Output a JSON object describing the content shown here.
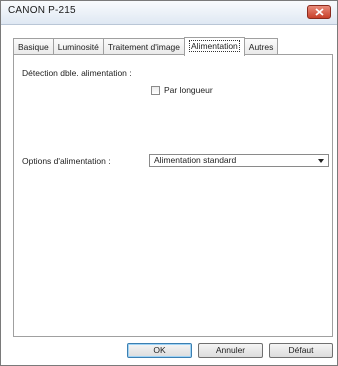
{
  "window": {
    "title": "CANON  P-215"
  },
  "tabs": [
    {
      "label": "Basique"
    },
    {
      "label": "Luminosité"
    },
    {
      "label": "Traitement d'image"
    },
    {
      "label": "Alimentation",
      "active": true
    },
    {
      "label": "Autres"
    }
  ],
  "panel": {
    "double_feed_label": "Détection dble. alimentation :",
    "by_length_checkbox": {
      "label": "Par longueur",
      "checked": false
    },
    "feed_options_label": "Options d'alimentation :",
    "feed_options_select": {
      "value": "Alimentation standard"
    }
  },
  "buttons": {
    "ok": "OK",
    "cancel": "Annuler",
    "default": "Défaut"
  },
  "colors": {
    "close_button": "#c8402a",
    "default_button_border": "#3c7fb1"
  }
}
